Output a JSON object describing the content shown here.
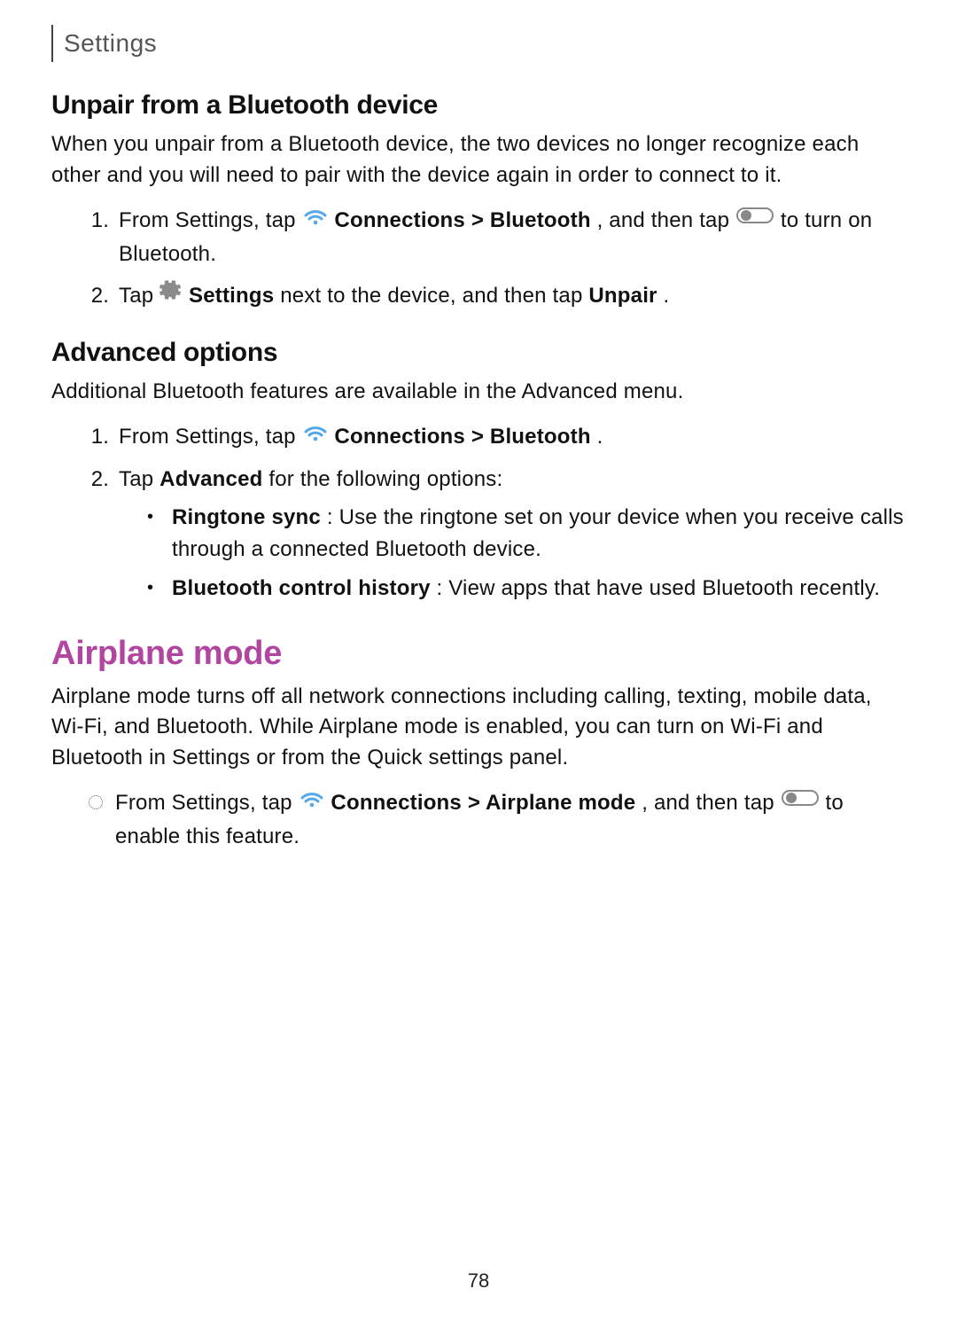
{
  "header": {
    "title": "Settings"
  },
  "section1": {
    "heading": "Unpair from a Bluetooth device",
    "intro": "When you unpair from a Bluetooth device, the two devices no longer recognize each other and you will need to pair with the device again in order to connect to it.",
    "step1": {
      "pre": "From Settings, tap ",
      "bold1": "Connections > Bluetooth",
      "mid1": ", and then tap ",
      "post": " to turn on Bluetooth."
    },
    "step2": {
      "pre": "Tap ",
      "bold_settings": "Settings",
      "mid": " next to the device, and then tap ",
      "bold_unpair": "Unpair",
      "post": "."
    }
  },
  "section2": {
    "heading": "Advanced options",
    "intro": "Additional Bluetooth features are available in the Advanced menu.",
    "step1": {
      "pre": "From Settings, tap ",
      "bold1": "Connections > Bluetooth",
      "post": "."
    },
    "step2": {
      "pre": "Tap ",
      "bold_adv": "Advanced",
      "post": " for the following options:"
    },
    "bullet1": {
      "bold": "Ringtone sync",
      "text": ": Use the ringtone set on your device when you receive calls through a connected Bluetooth device."
    },
    "bullet2": {
      "bold": "Bluetooth control history",
      "text": ": View apps that have used Bluetooth recently."
    }
  },
  "section3": {
    "heading": "Airplane mode",
    "intro": "Airplane mode turns off all network connections including calling, texting, mobile data, Wi-Fi, and Bluetooth. While Airplane mode is enabled, you can turn on Wi-Fi and Bluetooth in Settings or from the Quick settings panel.",
    "step": {
      "pre": "From Settings, tap ",
      "bold1": "Connections > Airplane mode",
      "mid1": ", and then tap ",
      "post": " to enable this feature."
    }
  },
  "page_number": "78",
  "icons": {
    "wifi_color": "#52a8e8",
    "gear_color": "#8a8a8a",
    "toggle_stroke": "#888"
  }
}
